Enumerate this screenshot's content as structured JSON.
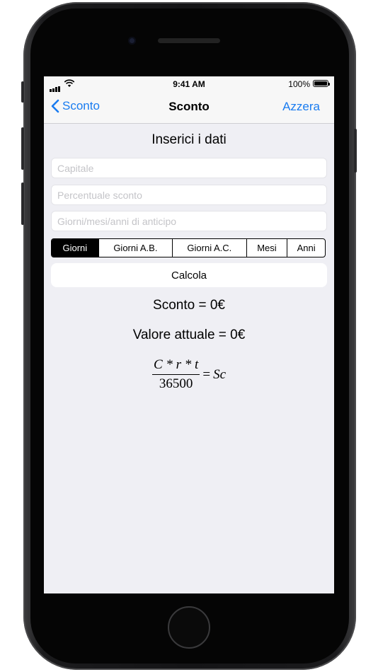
{
  "status_bar": {
    "time": "9:41 AM",
    "battery_percent": "100%",
    "battery_level": 1.0
  },
  "nav": {
    "back_label": "Sconto",
    "title": "Sconto",
    "right_label": "Azzera"
  },
  "form": {
    "title": "Inserici i dati",
    "capitale_placeholder": "Capitale",
    "percentuale_placeholder": "Percentuale sconto",
    "giorni_placeholder": "Giorni/mesi/anni di anticipo"
  },
  "segments": [
    "Giorni",
    "Giorni A.B.",
    "Giorni A.C.",
    "Mesi",
    "Anni"
  ],
  "selected_segment": "Giorni",
  "calc_label": "Calcola",
  "results": {
    "sconto": "Sconto = 0€",
    "valore_attuale": "Valore attuale = 0€"
  },
  "formula": {
    "numerator": "C * r * t",
    "denominator": "36500",
    "equals": "=",
    "rhs": "Sc"
  },
  "colors": {
    "accent": "#1a7cf0",
    "background": "#efeff4",
    "segment_active": "#000000"
  }
}
